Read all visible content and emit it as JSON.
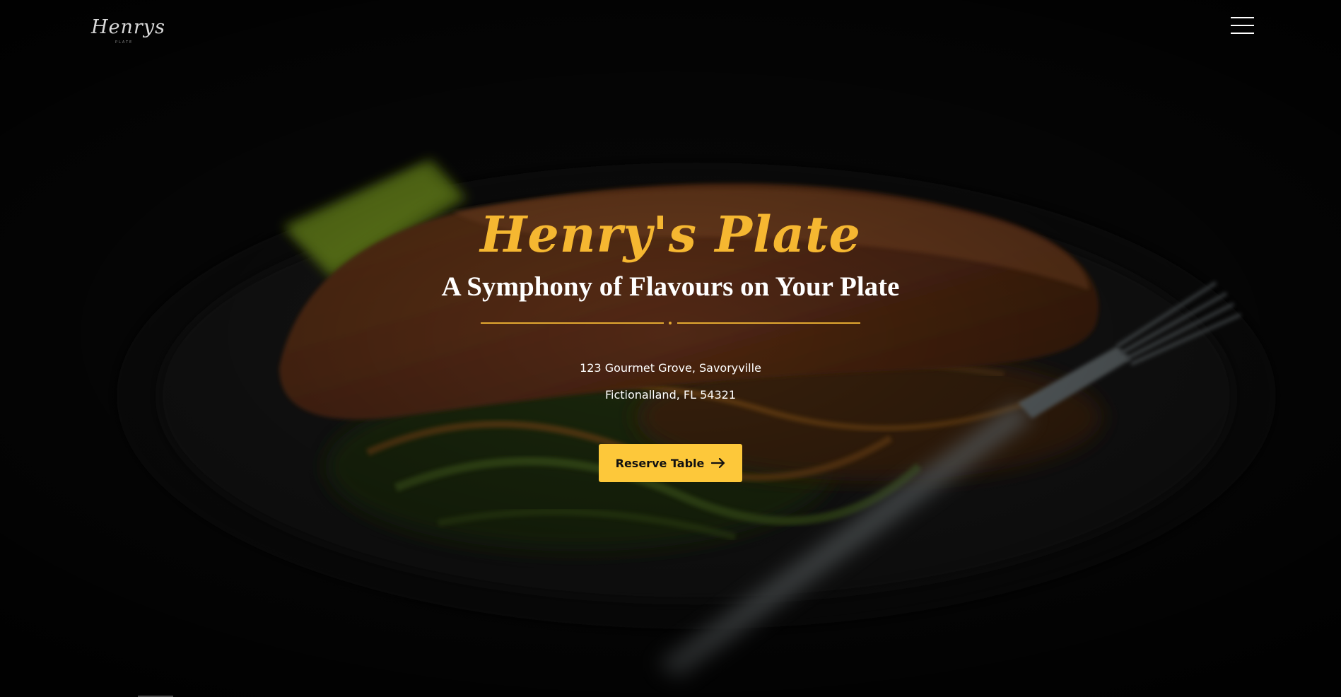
{
  "header": {
    "logo_text": "Henrys",
    "logo_subtext": "PLATE",
    "menu_icon": "hamburger-menu-icon"
  },
  "hero": {
    "background_image": "dark-salmon-plate-with-fork",
    "script_title": "Henry's Plate",
    "tagline": "A Symphony of Flavours on Your Plate",
    "address_line1": "123 Gourmet Grove, Savoryville",
    "address_line2": "Fictionalland, FL 54321",
    "cta_label": "Reserve Table",
    "cta_icon": "arrow-right-icon"
  },
  "colors": {
    "accent": "#fdc83a",
    "title_gold": "#f5b731",
    "divider": "#e2a831",
    "background": "#070707",
    "text": "#ffffff"
  }
}
